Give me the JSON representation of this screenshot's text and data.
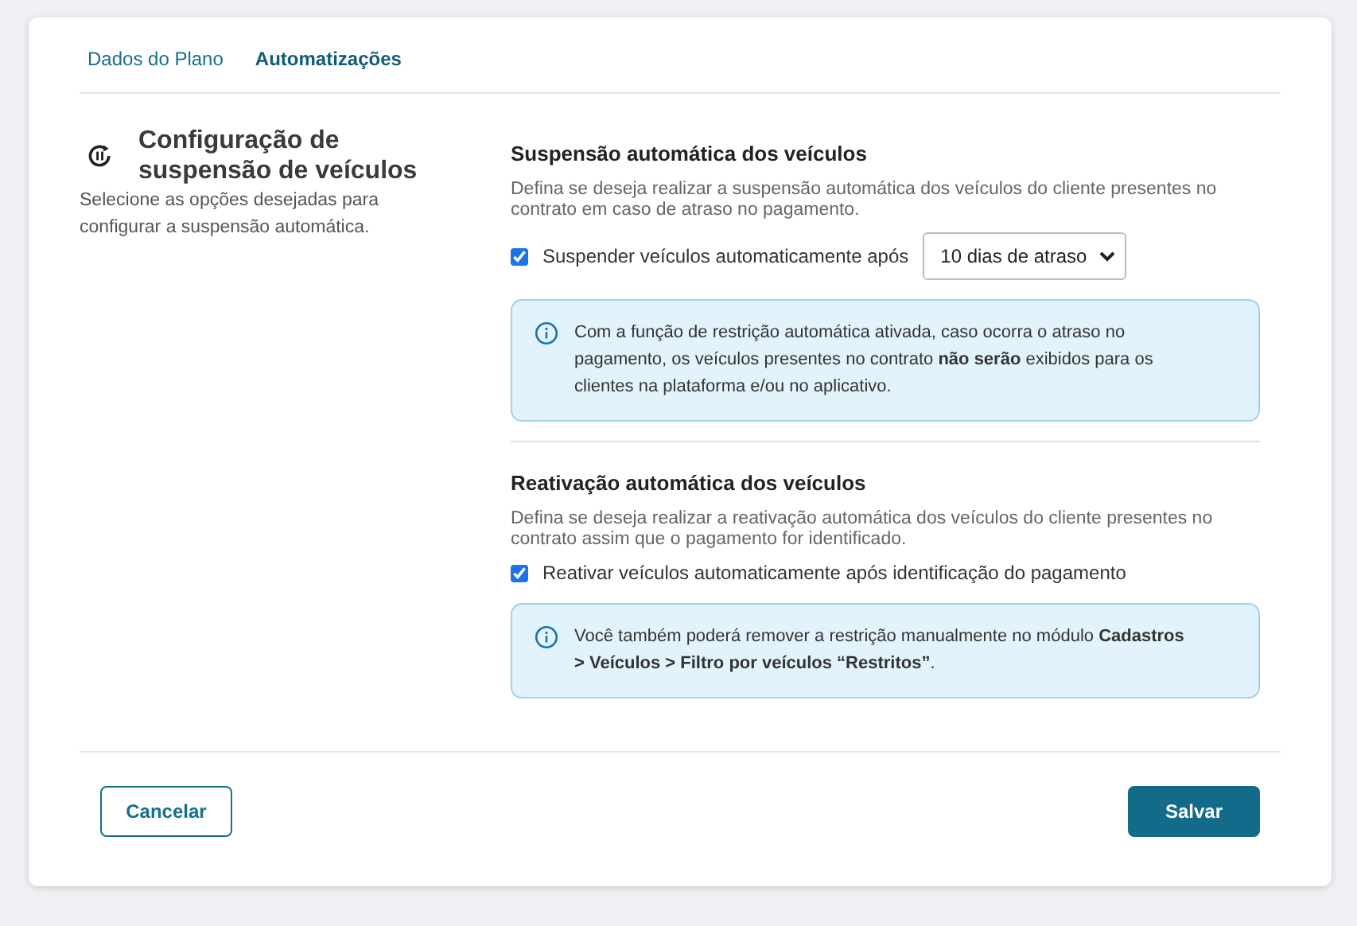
{
  "tabs": [
    {
      "label": "Dados do Plano",
      "selected": false
    },
    {
      "label": "Automatizações",
      "selected": true
    }
  ],
  "intro": {
    "title": "Configuração de suspensão de veículos",
    "description": "Selecione as opções desejadas para configurar a suspensão automática."
  },
  "sections": [
    {
      "title": "Suspensão automática dos veículos",
      "description": "Defina se deseja realizar a suspensão automática dos veículos do cliente presentes no contrato em caso de atraso no pagamento.",
      "option": {
        "label": "Suspender veículos automaticamente após",
        "checked": true,
        "select_value": "10 dias de atraso"
      },
      "info": "Com a função de restrição automática ativada, caso ocorra o atraso no pagamento, os veículos presentes no contrato **não serão** exibidos para os clientes na plataforma e/ou no aplicativo."
    },
    {
      "title": "Reativação automática dos veículos",
      "description": "Defina se deseja realizar a reativação automática dos veículos do cliente presentes no contrato assim que o pagamento for identificado.",
      "option": {
        "label": "Reativar veículos automaticamente após identificação do pagamento",
        "checked": true
      },
      "info": "Você também poderá remover a restrição manualmente no módulo **Cadastros > Veículos > Filtro por veículos “Restritos”**."
    }
  ],
  "buttons": [
    {
      "label": "Cancelar",
      "kind": "secondary"
    },
    {
      "label": "Salvar",
      "kind": "primary"
    }
  ]
}
